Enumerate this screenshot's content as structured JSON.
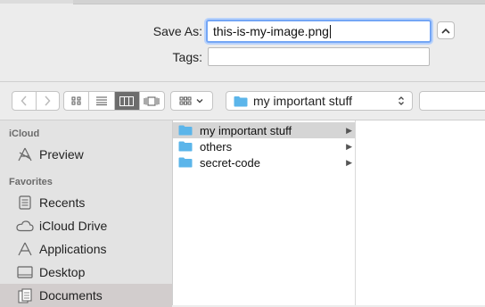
{
  "save_panel": {
    "save_as_label": "Save As:",
    "filename": "this-is-my-image.png",
    "tags_label": "Tags:",
    "tags_value": ""
  },
  "toolbar": {
    "location": "my important stuff",
    "icons": [
      "back-arrow-icon",
      "forward-arrow-icon",
      "icon-view-icon",
      "list-view-icon",
      "column-view-icon",
      "cover-flow-icon",
      "arrange-icon",
      "folder-icon",
      "updown-chevron-icon"
    ]
  },
  "sidebar": {
    "sections": [
      {
        "title": "iCloud",
        "items": [
          {
            "label": "Preview",
            "icon": "preview-app-icon"
          }
        ]
      },
      {
        "title": "Favorites",
        "items": [
          {
            "label": "Recents",
            "icon": "recents-icon"
          },
          {
            "label": "iCloud Drive",
            "icon": "cloud-icon"
          },
          {
            "label": "Applications",
            "icon": "applications-icon"
          },
          {
            "label": "Desktop",
            "icon": "desktop-icon"
          },
          {
            "label": "Documents",
            "icon": "documents-icon",
            "selected": true
          }
        ]
      }
    ]
  },
  "browser": {
    "column1": [
      {
        "label": "my important stuff",
        "selected": true
      },
      {
        "label": "others"
      },
      {
        "label": "secret-code"
      }
    ]
  },
  "colors": {
    "focus": "#74a6f5",
    "folder": "#5bb5ea"
  }
}
